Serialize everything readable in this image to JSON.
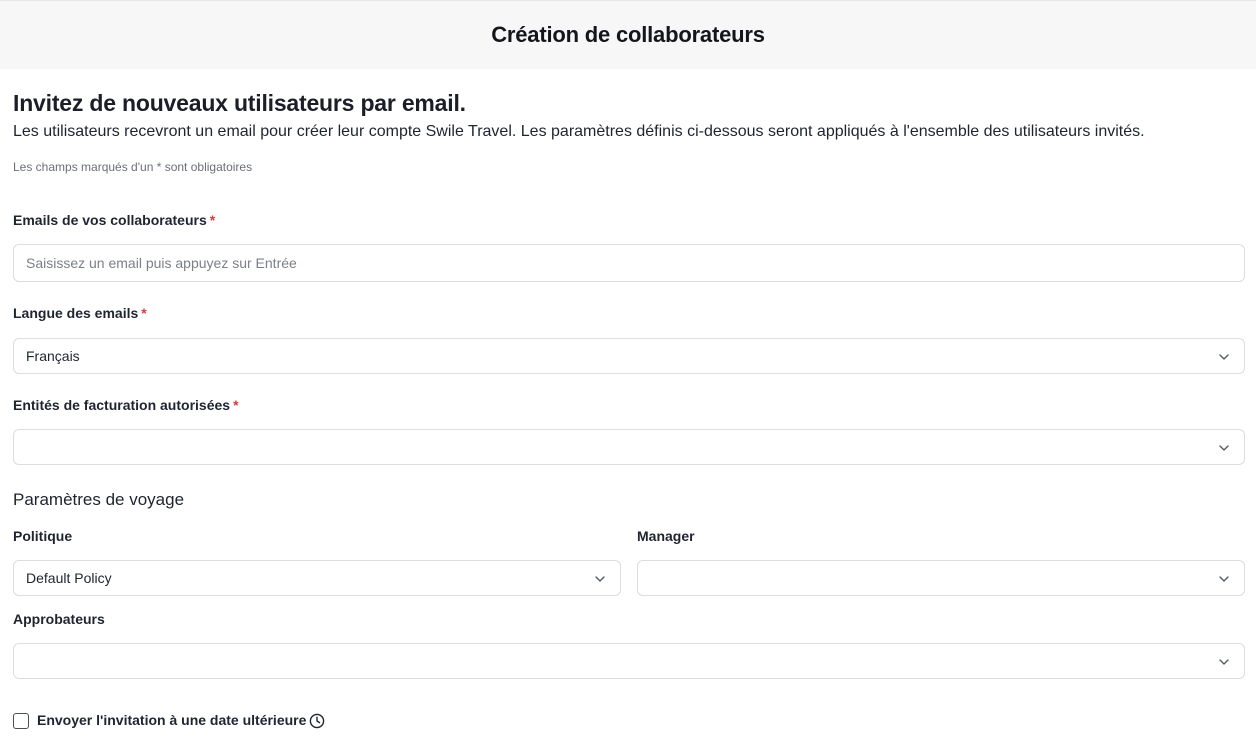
{
  "header": {
    "title": "Création de collaborateurs"
  },
  "intro": {
    "title": "Invitez de nouveaux utilisateurs par email.",
    "description": "Les utilisateurs recevront un email pour créer leur compte Swile Travel. Les paramètres définis ci-dessous seront appliqués à l'ensemble des utilisateurs invités.",
    "required_note": "Les champs marqués d'un * sont obligatoires"
  },
  "form": {
    "emails": {
      "label": "Emails de vos collaborateurs",
      "required_mark": "*",
      "placeholder": "Saisissez un email puis appuyez sur Entrée",
      "value": ""
    },
    "language": {
      "label": "Langue des emails",
      "required_mark": "*",
      "value": "Français"
    },
    "billing": {
      "label": "Entités de facturation autorisées",
      "required_mark": "*",
      "value": ""
    },
    "travel_section": "Paramètres de voyage",
    "policy": {
      "label": "Politique",
      "value": "Default Policy"
    },
    "manager": {
      "label": "Manager",
      "value": ""
    },
    "approvers": {
      "label": "Approbateurs",
      "value": ""
    },
    "schedule": {
      "label": "Envoyer l'invitation à une date ultérieure",
      "checked": false
    }
  },
  "icons": {
    "select": "chevron-down-icon",
    "schedule": "clock-icon"
  },
  "colors": {
    "required": "#d93a3a",
    "border": "#dcdde1",
    "header_bg": "#f7f7f7"
  }
}
